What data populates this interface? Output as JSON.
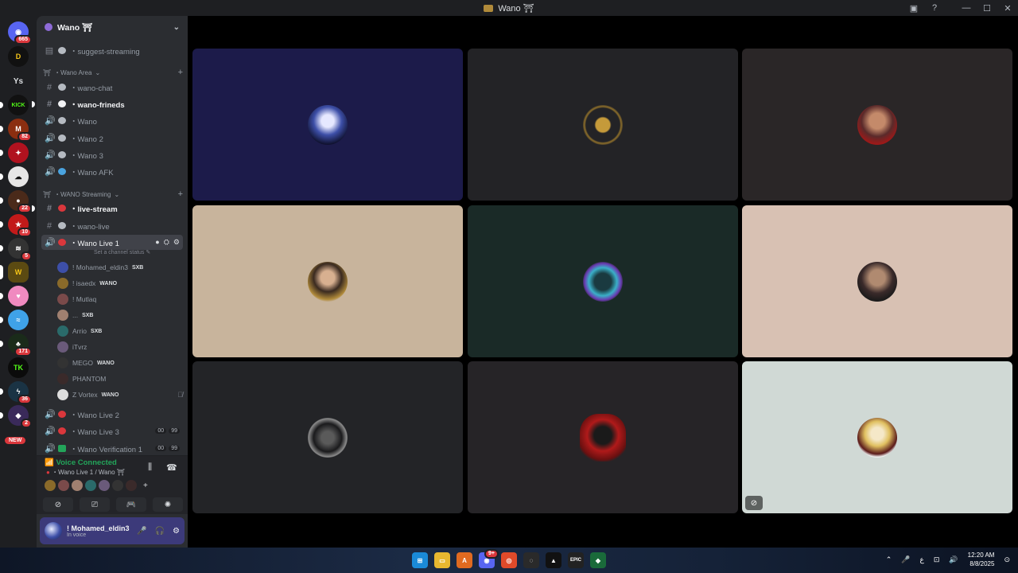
{
  "window": {
    "title": "Wano ⛩"
  },
  "rail": {
    "badges": [
      "665",
      "82",
      "22",
      "10",
      "5",
      "171",
      "36",
      "2"
    ],
    "ys_label": "Ys",
    "kick_label": "KICK",
    "new_label": "NEW"
  },
  "server": {
    "name": "Wano ⛩",
    "channels": {
      "suggest": "・suggest-streaming",
      "cat1": "・Wano Area",
      "wano_chat": "・wano-chat",
      "wano_frineds": "・wano-frineds",
      "wano": "・Wano",
      "wano2": "・Wano 2",
      "wano3": "・Wano 3",
      "wano_afk": "・Wano AFK",
      "cat2": "・WANO Streaming",
      "live_stream": "・live-stream",
      "wano_live": "・wano-live",
      "wano_live1": "・Wano Live 1",
      "status_hint": "Set a channel status",
      "wano_live2": "・Wano Live 2",
      "wano_live3": "・Wano Live 3",
      "wano_verif": "・Wano Verification 1"
    },
    "pills": {
      "a": "00",
      "b": "99"
    },
    "voice_users": [
      {
        "name": "! Mohamed_eldin3",
        "tag": "SXB"
      },
      {
        "name": "! isaedx",
        "tag": "WANO"
      },
      {
        "name": "! Mutlaq",
        "tag": ""
      },
      {
        "name": "...",
        "tag": "SXB"
      },
      {
        "name": "Arrio",
        "tag": "SXB"
      },
      {
        "name": "iTvrz",
        "tag": ""
      },
      {
        "name": "MEGO",
        "tag": "WANO"
      },
      {
        "name": "PHANTOM",
        "tag": ""
      },
      {
        "name": "Z Vortex",
        "tag": "WANO"
      }
    ]
  },
  "voice_panel": {
    "status": "Voice Connected",
    "location": "・Wano Live 1 / Wano ⛩"
  },
  "user": {
    "name": "! Mohamed_eldin3",
    "state": "In voice"
  },
  "taskbar": {
    "time": "12:20 AM",
    "date": "8/8/2025",
    "epic_label": "EPIC",
    "discord_badge": "9+"
  },
  "colors": {
    "tile1": "#1c1b4a",
    "tile2": "#232326",
    "tile3": "#2a2627",
    "tile4": "#c8b49c",
    "tile5": "#1a2a27",
    "tile6": "#d8c1b3",
    "tile7": "#232427",
    "tile8": "#262427",
    "tile9": "#d0d9d5"
  }
}
